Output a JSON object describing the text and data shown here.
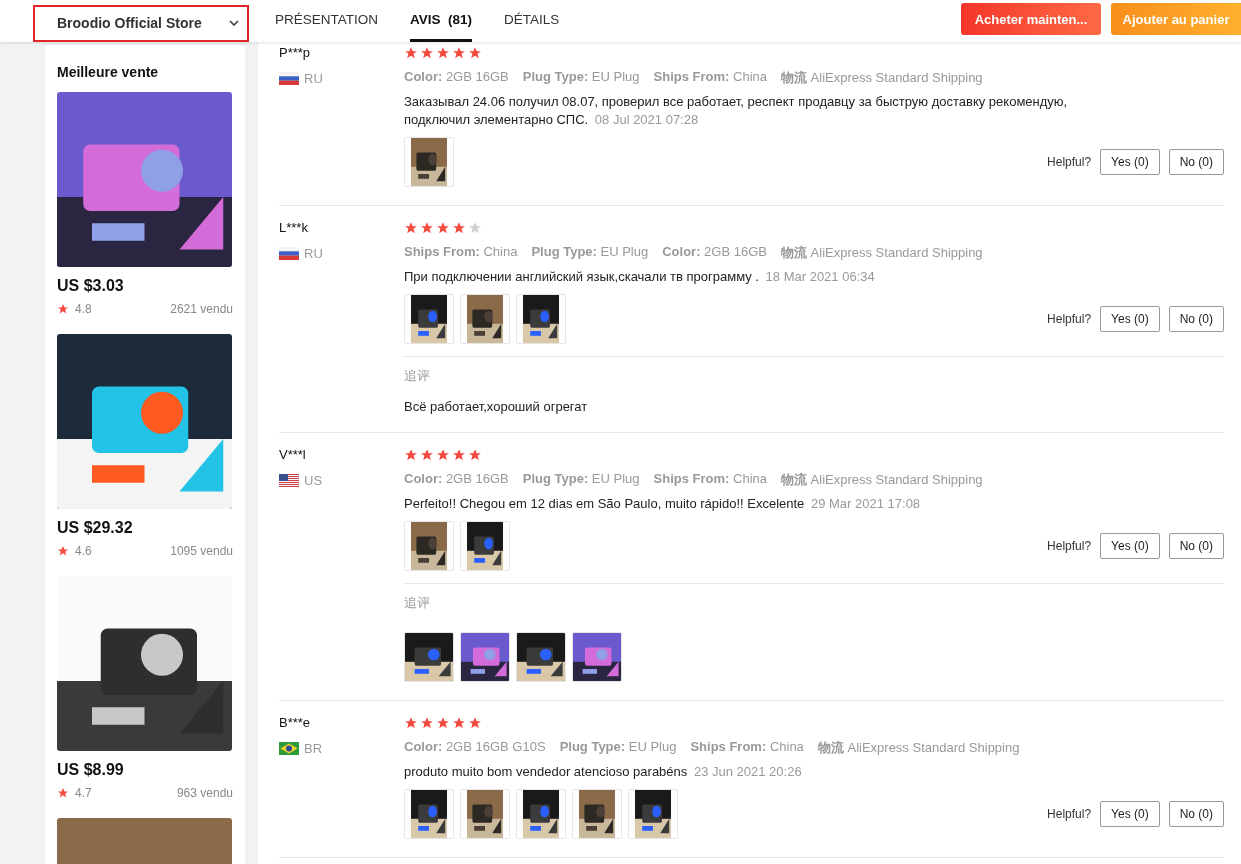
{
  "store_selector": {
    "label": "Broodio Official Store"
  },
  "tabs": [
    {
      "label": "PRÉSENTATION",
      "selected": false
    },
    {
      "label": "AVIS",
      "count": "(81)",
      "selected": true
    },
    {
      "label": "DÉTAILS",
      "selected": false
    }
  ],
  "actions": [
    {
      "label": "Acheter mainten...",
      "kind": "buy"
    },
    {
      "label": "Ajouter au panier",
      "kind": "cart"
    }
  ],
  "sidebar": {
    "title": "Meilleure vente",
    "products": [
      {
        "picture": {
          "kind": "picture"
        },
        "price": "US $3.03",
        "rating": "4.8",
        "sold": "2621 vendu"
      },
      {
        "picture": {
          "kind": "picture"
        },
        "price": "US $29.32",
        "rating": "4.6",
        "sold": "1095 vendu"
      },
      {
        "picture": {
          "kind": "picture"
        },
        "price": "US $8.99",
        "rating": "4.7",
        "sold": "963 vendu"
      },
      {
        "picture": {
          "kind": "picture"
        }
      }
    ]
  },
  "reviews": [
    {
      "name": "P***p",
      "flag": {
        "kind": "ru"
      },
      "country": "RU",
      "stars": 5,
      "attributes": [
        {
          "label": "Color:",
          "value": "2GB 16GB"
        },
        {
          "label": "Plug Type:",
          "value": "EU Plug"
        },
        {
          "label": "Ships From:",
          "value": "China"
        },
        {
          "label": "物流",
          "value": "AliExpress Standard Shipping"
        }
      ],
      "text": "Заказывал 24.06 получил 08.07, проверил все работает, респект продавцу за быструю доставку рекомендую, подключил элементарно СПС.",
      "date": "08 Jul 2021 07:28",
      "photos": [
        {
          "kind": "picture"
        }
      ],
      "helpful": {
        "label": "Helpful?",
        "yes": "Yes (0)",
        "no": "No (0)"
      }
    },
    {
      "name": "L***k",
      "flag": {
        "kind": "ru"
      },
      "country": "RU",
      "stars": 4,
      "attributes": [
        {
          "label": "Ships From:",
          "value": "China"
        },
        {
          "label": "Plug Type:",
          "value": "EU Plug"
        },
        {
          "label": "Color:",
          "value": "2GB 16GB"
        },
        {
          "label": "物流",
          "value": "AliExpress Standard Shipping"
        }
      ],
      "text": "При подключении английский язык,скачали тв программу .",
      "date": "18 Mar 2021 06:34",
      "photos": [
        {
          "kind": "picture"
        },
        {
          "kind": "picture"
        },
        {
          "kind": "picture"
        }
      ],
      "helpful": {
        "label": "Helpful?",
        "yes": "Yes (0)",
        "no": "No (0)"
      },
      "followup": {
        "label": "追评",
        "text": "Всё работает,хороший огрегат"
      }
    },
    {
      "name": "V***l",
      "flag": {
        "kind": "us"
      },
      "country": "US",
      "stars": 5,
      "attributes": [
        {
          "label": "Color:",
          "value": "2GB 16GB"
        },
        {
          "label": "Plug Type:",
          "value": "EU Plug"
        },
        {
          "label": "Ships From:",
          "value": "China"
        },
        {
          "label": "物流",
          "value": "AliExpress Standard Shipping"
        }
      ],
      "text": "Perfeito!! Chegou em 12 dias em São Paulo, muito rápido!! Excelente",
      "date": "29 Mar 2021 17:08",
      "photos": [
        {
          "kind": "picture"
        },
        {
          "kind": "picture"
        }
      ],
      "helpful": {
        "label": "Helpful?",
        "yes": "Yes (0)",
        "no": "No (0)"
      },
      "followup": {
        "label": "追评",
        "photos": [
          {
            "kind": "picture"
          },
          {
            "kind": "picture"
          },
          {
            "kind": "picture"
          },
          {
            "kind": "picture"
          }
        ]
      }
    },
    {
      "name": "B***e",
      "flag": {
        "kind": "br"
      },
      "country": "BR",
      "stars": 5,
      "attributes": [
        {
          "label": "Color:",
          "value": "2GB 16GB G10S"
        },
        {
          "label": "Plug Type:",
          "value": "EU Plug"
        },
        {
          "label": "Ships From:",
          "value": "China"
        },
        {
          "label": "物流",
          "value": "AliExpress Standard Shipping"
        }
      ],
      "text": "produto muito bom vendedor atencioso parabéns",
      "date": "23 Jun 2021 20:26",
      "photos": [
        {
          "kind": "picture"
        },
        {
          "kind": "picture"
        },
        {
          "kind": "picture"
        },
        {
          "kind": "picture"
        },
        {
          "kind": "picture"
        }
      ],
      "helpful": {
        "label": "Helpful?",
        "yes": "Yes (0)",
        "no": "No (0)"
      }
    }
  ]
}
